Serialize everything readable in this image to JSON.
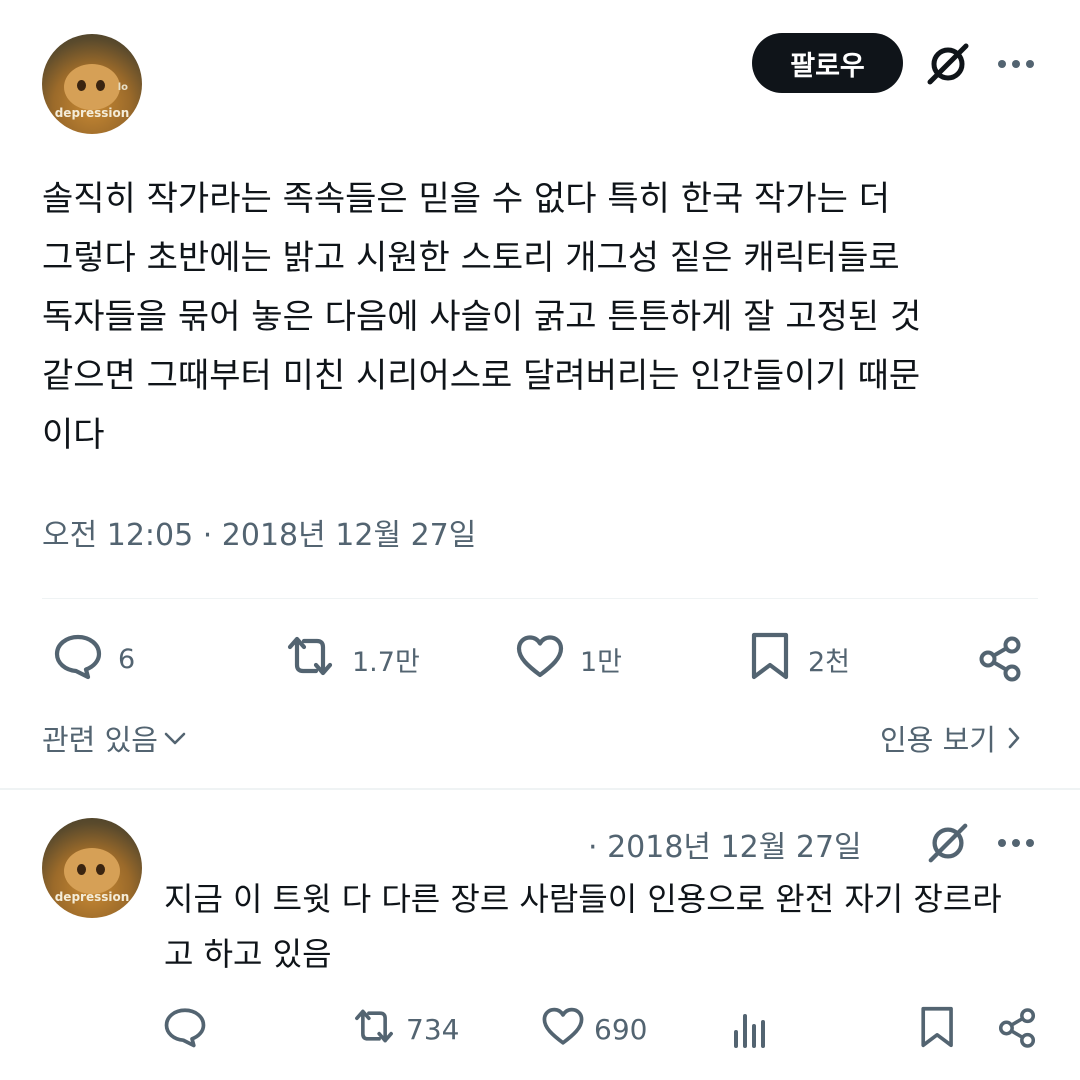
{
  "main_tweet": {
    "avatar_text": "depression",
    "avatar_side_text": "lo",
    "follow_label": "팔로우",
    "body_lines": [
      "솔직히 작가라는 족속들은 믿을 수 없다 특히 한국 작가는 더",
      "그렇다 초반에는 밝고 시원한 스토리 개그성 짙은 캐릭터들로",
      "독자들을 묶어 놓은 다음에 사슬이 굵고 튼튼하게 잘 고정된 것",
      "같으면 그때부터 미친 시리어스로 달려버리는 인간들이기 때문",
      "이다"
    ],
    "timestamp": "오전 12:05 · 2018년 12월 27일",
    "stats": {
      "replies": "6",
      "retweets": "1.7만",
      "likes": "1만",
      "bookmarks": "2천"
    },
    "related_label": "관련 있음",
    "quotes_label": "인용 보기"
  },
  "reply_tweet": {
    "avatar_text": "depression",
    "date": "· 2018년 12월 27일",
    "body_lines": [
      "지금 이 트윗 다 다른 장르 사람들이 인용으로 완전 자기 장르라",
      "고 하고 있음"
    ],
    "stats": {
      "retweets": "734",
      "likes": "690"
    }
  },
  "colors": {
    "text": "#0f1419",
    "secondary": "#536471",
    "divider": "#eff3f4"
  },
  "icons": [
    "grok-icon",
    "more-icon",
    "reply-icon",
    "retweet-icon",
    "like-icon",
    "bookmark-icon",
    "share-icon",
    "chevron-down-icon",
    "chevron-right-icon",
    "analytics-icon"
  ]
}
